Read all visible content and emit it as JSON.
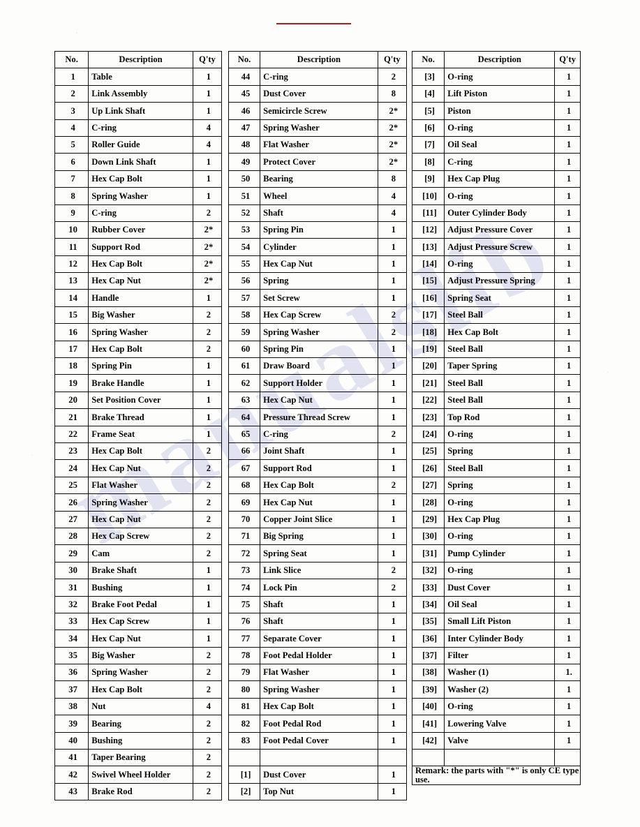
{
  "document": {
    "type": "parts-list-table",
    "red_rule_color": "#b41a1e",
    "watermark_text": "manualslib"
  },
  "columns": [
    {
      "headers": {
        "no": "No.",
        "description": "Description",
        "qty": "Q'ty"
      },
      "rows": [
        {
          "no": "1",
          "description": "Table",
          "qty": "1"
        },
        {
          "no": "2",
          "description": "Link Assembly",
          "qty": "1"
        },
        {
          "no": "3",
          "description": "Up Link Shaft",
          "qty": "1"
        },
        {
          "no": "4",
          "description": "C-ring",
          "qty": "4"
        },
        {
          "no": "5",
          "description": "Roller Guide",
          "qty": "4"
        },
        {
          "no": "6",
          "description": "Down Link Shaft",
          "qty": "1"
        },
        {
          "no": "7",
          "description": "Hex Cap Bolt",
          "qty": "1"
        },
        {
          "no": "8",
          "description": "Spring Washer",
          "qty": "1"
        },
        {
          "no": "9",
          "description": "C-ring",
          "qty": "2"
        },
        {
          "no": "10",
          "description": "Rubber Cover",
          "qty": "2*"
        },
        {
          "no": "11",
          "description": "Support Rod",
          "qty": "2*"
        },
        {
          "no": "12",
          "description": "Hex Cap Bolt",
          "qty": "2*"
        },
        {
          "no": "13",
          "description": "Hex Cap Nut",
          "qty": "2*"
        },
        {
          "no": "14",
          "description": "Handle",
          "qty": "1"
        },
        {
          "no": "15",
          "description": "Big Washer",
          "qty": "2"
        },
        {
          "no": "16",
          "description": "Spring Washer",
          "qty": "2"
        },
        {
          "no": "17",
          "description": "Hex Cap Bolt",
          "qty": "2"
        },
        {
          "no": "18",
          "description": "Spring Pin",
          "qty": "1"
        },
        {
          "no": "19",
          "description": "Brake Handle",
          "qty": "1"
        },
        {
          "no": "20",
          "description": "Set Position Cover",
          "qty": "1"
        },
        {
          "no": "21",
          "description": "Brake Thread",
          "qty": "1"
        },
        {
          "no": "22",
          "description": "Frame Seat",
          "qty": "1"
        },
        {
          "no": "23",
          "description": "Hex Cap Bolt",
          "qty": "2"
        },
        {
          "no": "24",
          "description": "Hex Cap Nut",
          "qty": "2"
        },
        {
          "no": "25",
          "description": "Flat Washer",
          "qty": "2"
        },
        {
          "no": "26",
          "description": "Spring Washer",
          "qty": "2"
        },
        {
          "no": "27",
          "description": "Hex Cap Nut",
          "qty": "2"
        },
        {
          "no": "28",
          "description": "Hex Cap Screw",
          "qty": "2"
        },
        {
          "no": "29",
          "description": "Cam",
          "qty": "2"
        },
        {
          "no": "30",
          "description": "Brake Shaft",
          "qty": "1"
        },
        {
          "no": "31",
          "description": "Bushing",
          "qty": "1"
        },
        {
          "no": "32",
          "description": "Brake Foot Pedal",
          "qty": "1"
        },
        {
          "no": "33",
          "description": "Hex Cap Screw",
          "qty": "1"
        },
        {
          "no": "34",
          "description": "Hex Cap Nut",
          "qty": "1"
        },
        {
          "no": "35",
          "description": "Big Washer",
          "qty": "2"
        },
        {
          "no": "36",
          "description": "Spring Washer",
          "qty": "2"
        },
        {
          "no": "37",
          "description": "Hex Cap Bolt",
          "qty": "2"
        },
        {
          "no": "38",
          "description": "Nut",
          "qty": "4"
        },
        {
          "no": "39",
          "description": "Bearing",
          "qty": "2"
        },
        {
          "no": "40",
          "description": "Bushing",
          "qty": "2"
        },
        {
          "no": "41",
          "description": "Taper Bearing",
          "qty": "2"
        },
        {
          "no": "42",
          "description": "Swivel Wheel Holder",
          "qty": "2"
        },
        {
          "no": "43",
          "description": "Brake Rod",
          "qty": "2"
        }
      ]
    },
    {
      "headers": {
        "no": "No.",
        "description": "Description",
        "qty": "Q'ty"
      },
      "rows": [
        {
          "no": "44",
          "description": "C-ring",
          "qty": "2"
        },
        {
          "no": "45",
          "description": "Dust Cover",
          "qty": "8"
        },
        {
          "no": "46",
          "description": "Semicircle Screw",
          "qty": "2*"
        },
        {
          "no": "47",
          "description": "Spring Washer",
          "qty": "2*"
        },
        {
          "no": "48",
          "description": "Flat Washer",
          "qty": "2*"
        },
        {
          "no": "49",
          "description": "Protect Cover",
          "qty": "2*"
        },
        {
          "no": "50",
          "description": "Bearing",
          "qty": "8"
        },
        {
          "no": "51",
          "description": "Wheel",
          "qty": "4"
        },
        {
          "no": "52",
          "description": "Shaft",
          "qty": "4"
        },
        {
          "no": "53",
          "description": "Spring Pin",
          "qty": "1"
        },
        {
          "no": "54",
          "description": "Cylinder",
          "qty": "1"
        },
        {
          "no": "55",
          "description": "Hex Cap Nut",
          "qty": "1"
        },
        {
          "no": "56",
          "description": "Spring",
          "qty": "1"
        },
        {
          "no": "57",
          "description": "Set Screw",
          "qty": "1"
        },
        {
          "no": "58",
          "description": "Hex Cap Screw",
          "qty": "2"
        },
        {
          "no": "59",
          "description": "Spring Washer",
          "qty": "2"
        },
        {
          "no": "60",
          "description": "Spring Pin",
          "qty": "1"
        },
        {
          "no": "61",
          "description": "Draw Board",
          "qty": "1"
        },
        {
          "no": "62",
          "description": "Support Holder",
          "qty": "1"
        },
        {
          "no": "63",
          "description": "Hex Cap Nut",
          "qty": "1"
        },
        {
          "no": "64",
          "description": "Pressure Thread Screw",
          "qty": "1"
        },
        {
          "no": "65",
          "description": "C-ring",
          "qty": "2"
        },
        {
          "no": "66",
          "description": "Joint Shaft",
          "qty": "1"
        },
        {
          "no": "67",
          "description": "Support Rod",
          "qty": "1"
        },
        {
          "no": "68",
          "description": "Hex Cap Bolt",
          "qty": "2"
        },
        {
          "no": "69",
          "description": "Hex Cap Nut",
          "qty": "1"
        },
        {
          "no": "70",
          "description": "Copper Joint Slice",
          "qty": "1"
        },
        {
          "no": "71",
          "description": "Big Spring",
          "qty": "1"
        },
        {
          "no": "72",
          "description": "Spring Seat",
          "qty": "1"
        },
        {
          "no": "73",
          "description": "Link Slice",
          "qty": "2"
        },
        {
          "no": "74",
          "description": "Lock Pin",
          "qty": "2"
        },
        {
          "no": "75",
          "description": "Shaft",
          "qty": "1"
        },
        {
          "no": "76",
          "description": "Shaft",
          "qty": "1"
        },
        {
          "no": "77",
          "description": "Separate Cover",
          "qty": "1"
        },
        {
          "no": "78",
          "description": "Foot Pedal Holder",
          "qty": "1"
        },
        {
          "no": "79",
          "description": "Flat Washer",
          "qty": "1"
        },
        {
          "no": "80",
          "description": "Spring Washer",
          "qty": "1"
        },
        {
          "no": "81",
          "description": "Hex Cap Bolt",
          "qty": "1"
        },
        {
          "no": "82",
          "description": "Foot Pedal Rod",
          "qty": "1"
        },
        {
          "no": "83",
          "description": "Foot Pedal Cover",
          "qty": "1"
        },
        {
          "no": "",
          "description": "",
          "qty": ""
        },
        {
          "no": "[1]",
          "description": "Dust Cover",
          "qty": "1"
        },
        {
          "no": "[2]",
          "description": "Top Nut",
          "qty": "1"
        }
      ]
    },
    {
      "headers": {
        "no": "No.",
        "description": "Description",
        "qty": "Q'ty"
      },
      "rows": [
        {
          "no": "[3]",
          "description": "O-ring",
          "qty": "1"
        },
        {
          "no": "[4]",
          "description": "Lift Piston",
          "qty": "1"
        },
        {
          "no": "[5]",
          "description": "Piston",
          "qty": "1"
        },
        {
          "no": "[6]",
          "description": "O-ring",
          "qty": "1"
        },
        {
          "no": "[7]",
          "description": "Oil Seal",
          "qty": "1"
        },
        {
          "no": "[8]",
          "description": "C-ring",
          "qty": "1"
        },
        {
          "no": "[9]",
          "description": "Hex Cap Plug",
          "qty": "1"
        },
        {
          "no": "[10]",
          "description": "O-ring",
          "qty": "1"
        },
        {
          "no": "[11]",
          "description": "Outer Cylinder Body",
          "qty": "1"
        },
        {
          "no": "[12]",
          "description": "Adjust Pressure Cover",
          "qty": "1"
        },
        {
          "no": "[13]",
          "description": "Adjust Pressure Screw",
          "qty": "1"
        },
        {
          "no": "[14]",
          "description": "O-ring",
          "qty": "1"
        },
        {
          "no": "[15]",
          "description": "Adjust Pressure Spring",
          "qty": "1"
        },
        {
          "no": "[16]",
          "description": "Spring Seat",
          "qty": "1"
        },
        {
          "no": "[17]",
          "description": "Steel Ball",
          "qty": "1"
        },
        {
          "no": "[18]",
          "description": "Hex Cap Bolt",
          "qty": "1"
        },
        {
          "no": "[19]",
          "description": "Steel Ball",
          "qty": "1"
        },
        {
          "no": "[20]",
          "description": "Taper Spring",
          "qty": "1"
        },
        {
          "no": "[21]",
          "description": "Steel Ball",
          "qty": "1"
        },
        {
          "no": "[22]",
          "description": "Steel Ball",
          "qty": "1"
        },
        {
          "no": "[23]",
          "description": "Top Rod",
          "qty": "1"
        },
        {
          "no": "[24]",
          "description": "O-ring",
          "qty": "1"
        },
        {
          "no": "[25]",
          "description": "Spring",
          "qty": "1"
        },
        {
          "no": "[26]",
          "description": "Steel Ball",
          "qty": "1"
        },
        {
          "no": "[27]",
          "description": "Spring",
          "qty": "1"
        },
        {
          "no": "[28]",
          "description": "O-ring",
          "qty": "1"
        },
        {
          "no": "[29]",
          "description": "Hex Cap Plug",
          "qty": "1"
        },
        {
          "no": "[30]",
          "description": "O-ring",
          "qty": "1"
        },
        {
          "no": "[31]",
          "description": "Pump Cylinder",
          "qty": "1"
        },
        {
          "no": "[32]",
          "description": "O-ring",
          "qty": "1"
        },
        {
          "no": "[33]",
          "description": "Dust Cover",
          "qty": "1"
        },
        {
          "no": "[34]",
          "description": "Oil Seal",
          "qty": "1"
        },
        {
          "no": "[35]",
          "description": "Small Lift Piston",
          "qty": "1"
        },
        {
          "no": "[36]",
          "description": "Inter Cylinder Body",
          "qty": "1"
        },
        {
          "no": "[37]",
          "description": "Filter",
          "qty": "1"
        },
        {
          "no": "[38]",
          "description": "Washer (1)",
          "qty": "1."
        },
        {
          "no": "[39]",
          "description": "Washer (2)",
          "qty": "1"
        },
        {
          "no": "[40]",
          "description": "O-ring",
          "qty": "1"
        },
        {
          "no": "[41]",
          "description": "Lowering Valve",
          "qty": "1"
        },
        {
          "no": "[42]",
          "description": "Valve",
          "qty": "1"
        },
        {
          "no": "",
          "description": "",
          "qty": ""
        }
      ],
      "remark": "Remark: the parts with \"*\" is only CE type use."
    }
  ]
}
